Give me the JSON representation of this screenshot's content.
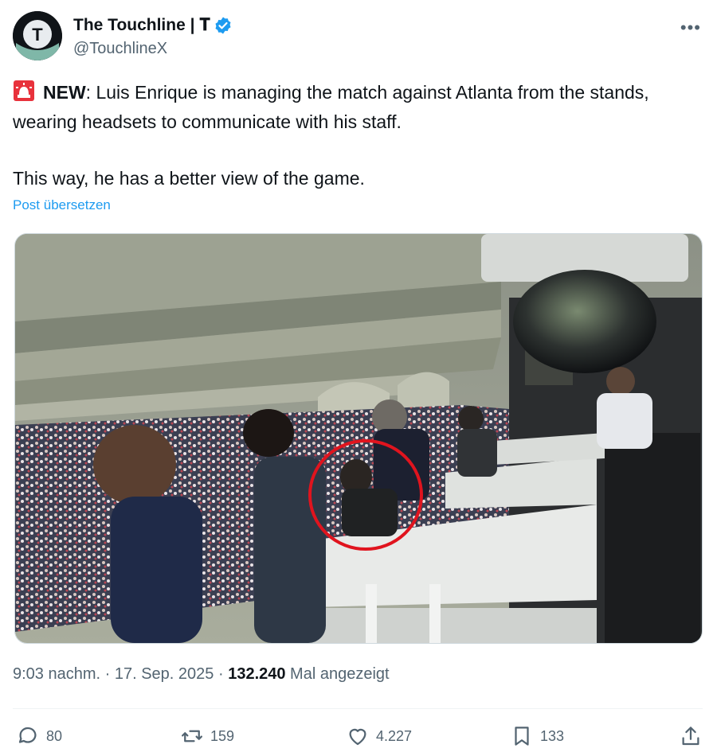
{
  "author": {
    "display_name": "The Touchline | 𝐓",
    "handle": "@TouchlineX",
    "avatar_letter": "T",
    "verified": true
  },
  "tweet": {
    "emoji": "rotating-light-icon",
    "label": "NEW",
    "line1": ": Luis Enrique is managing the match against Atlanta from the stands, wearing headsets to communicate with his staff.",
    "line2": "This way, he has a better view of the game.",
    "translate_label": "Post übersetzen"
  },
  "meta": {
    "time": "9:03 nachm.",
    "sep1": " · ",
    "date": "17. Sep. 2025",
    "sep2": " · ",
    "views": "132.240",
    "views_label": " Mal angezeigt"
  },
  "actions": {
    "replies": "80",
    "reposts": "159",
    "likes": "4.227",
    "bookmarks": "133"
  },
  "colors": {
    "link": "#1d9bf0",
    "muted": "#536471",
    "verified": "#1d9bf0",
    "highlight_circle": "#e0141e"
  }
}
